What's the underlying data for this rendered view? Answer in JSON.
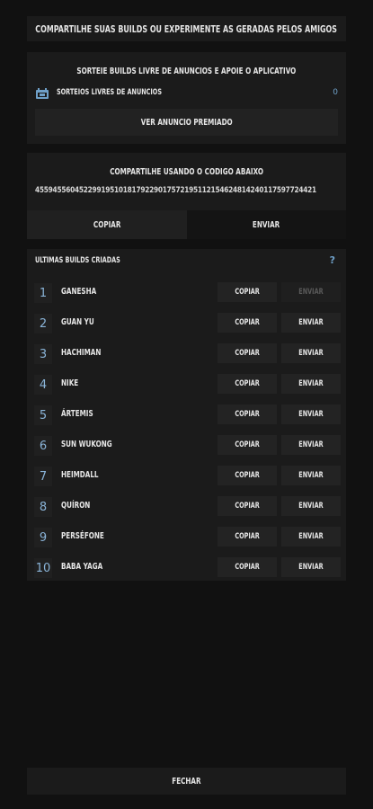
{
  "header": {
    "text": "COMPARTILHE SUAS BUILDS OU EXPERIMENTE AS GERADAS PELOS AMIGOS"
  },
  "raffle": {
    "title": "SORTEIE BUILDS LIVRE DE ANUNCIOS E APOIE O APLICATIVO",
    "label": "SORTEIOS LIVRES DE ANUNCIOS",
    "count": "0",
    "icon": "ticket-icon",
    "ad_button": "VER ANUNCIO PREMIADO"
  },
  "share": {
    "title": "COMPARTILHE USANDO O CODIGO ABAIXO",
    "code": "4559455604522991951018179229017572195112154624814240117597724421",
    "copy_label": "COPIAR",
    "send_label": "ENVIAR"
  },
  "builds": {
    "title": "ULTIMAS BUILDS CRIADAS",
    "help_icon": "?",
    "copy_label": "COPIAR",
    "send_label": "ENVIAR",
    "items": [
      {
        "num": "1",
        "name": "GANESHA",
        "send_enabled": false
      },
      {
        "num": "2",
        "name": "GUAN YU",
        "send_enabled": true
      },
      {
        "num": "3",
        "name": "HACHIMAN",
        "send_enabled": true
      },
      {
        "num": "4",
        "name": "NIKE",
        "send_enabled": true
      },
      {
        "num": "5",
        "name": "ÁRTEMIS",
        "send_enabled": true
      },
      {
        "num": "6",
        "name": "SUN WUKONG",
        "send_enabled": true
      },
      {
        "num": "7",
        "name": "HEIMDALL",
        "send_enabled": true
      },
      {
        "num": "8",
        "name": "QUÍRON",
        "send_enabled": true
      },
      {
        "num": "9",
        "name": "PERSÉFONE",
        "send_enabled": true
      },
      {
        "num": "10",
        "name": "BABA YAGA",
        "send_enabled": true
      }
    ]
  },
  "footer": {
    "close_label": "FECHAR"
  },
  "colors": {
    "accent": "#6fa0c8",
    "panel": "#1b1b1b",
    "background": "#111111"
  }
}
